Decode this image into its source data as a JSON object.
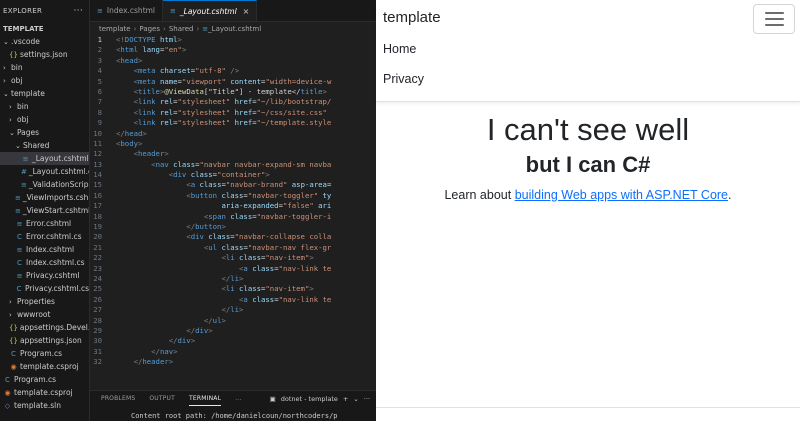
{
  "explorer": {
    "title": "EXPLORER",
    "menu_icon": "ellipsis-icon",
    "root": "TEMPLATE",
    "items": [
      {
        "label": ".vscode",
        "kind": "folder",
        "open": true,
        "depth": 0
      },
      {
        "label": "settings.json",
        "kind": "json",
        "depth": 1
      },
      {
        "label": "bin",
        "kind": "folder",
        "open": false,
        "depth": 0
      },
      {
        "label": "obj",
        "kind": "folder",
        "open": false,
        "depth": 0
      },
      {
        "label": "template",
        "kind": "folder",
        "open": true,
        "depth": 0
      },
      {
        "label": "bin",
        "kind": "folder",
        "open": false,
        "depth": 1
      },
      {
        "label": "obj",
        "kind": "folder",
        "open": false,
        "depth": 1
      },
      {
        "label": "Pages",
        "kind": "folder",
        "open": true,
        "depth": 1
      },
      {
        "label": "Shared",
        "kind": "folder",
        "open": true,
        "depth": 2
      },
      {
        "label": "_Layout.cshtml",
        "kind": "cshtml",
        "depth": 3,
        "selected": true
      },
      {
        "label": "_Layout.cshtml.css",
        "kind": "css",
        "depth": 3
      },
      {
        "label": "_ValidationScrip...",
        "kind": "cshtml",
        "depth": 3
      },
      {
        "label": "_ViewImports.csh...",
        "kind": "cshtml",
        "depth": 2
      },
      {
        "label": "_ViewStart.cshtml",
        "kind": "cshtml",
        "depth": 2
      },
      {
        "label": "Error.cshtml",
        "kind": "cshtml",
        "depth": 2
      },
      {
        "label": "Error.cshtml.cs",
        "kind": "cs",
        "depth": 2
      },
      {
        "label": "Index.cshtml",
        "kind": "cshtml",
        "depth": 2
      },
      {
        "label": "Index.cshtml.cs",
        "kind": "cs",
        "depth": 2
      },
      {
        "label": "Privacy.cshtml",
        "kind": "cshtml",
        "depth": 2
      },
      {
        "label": "Privacy.cshtml.cs",
        "kind": "cs",
        "depth": 2
      },
      {
        "label": "Properties",
        "kind": "folder",
        "open": false,
        "depth": 1
      },
      {
        "label": "wwwroot",
        "kind": "folder",
        "open": false,
        "depth": 1
      },
      {
        "label": "appsettings.Devel...",
        "kind": "json",
        "depth": 1
      },
      {
        "label": "appsettings.json",
        "kind": "json",
        "depth": 1
      },
      {
        "label": "Program.cs",
        "kind": "cs",
        "depth": 1
      },
      {
        "label": "template.csproj",
        "kind": "rss",
        "depth": 1
      },
      {
        "label": "Program.cs",
        "kind": "cs",
        "depth": 0
      },
      {
        "label": "template.csproj",
        "kind": "rss",
        "depth": 0
      },
      {
        "label": "template.sln",
        "kind": "sln",
        "depth": 0
      }
    ]
  },
  "tabs": [
    {
      "label": "Index.cshtml",
      "active": false
    },
    {
      "label": "_Layout.cshtml",
      "active": true,
      "close": "×"
    }
  ],
  "breadcrumb": [
    "template",
    "Pages",
    "Shared",
    "_Layout.cshtml"
  ],
  "code": {
    "current_line": 1,
    "lines": [
      [
        [
          "p",
          "<!"
        ],
        [
          "t",
          "DOCTYPE"
        ],
        [
          "a",
          " html"
        ],
        [
          "p",
          ">"
        ]
      ],
      [
        [
          "p",
          "<"
        ],
        [
          "t",
          "html"
        ],
        [
          "a",
          " lang"
        ],
        [
          "d",
          "="
        ],
        [
          "s",
          "\"en\""
        ],
        [
          "p",
          ">"
        ]
      ],
      [
        [
          "p",
          "<"
        ],
        [
          "t",
          "head"
        ],
        [
          "p",
          ">"
        ]
      ],
      [
        [
          "d",
          "    "
        ],
        [
          "p",
          "<"
        ],
        [
          "t",
          "meta"
        ],
        [
          "a",
          " charset"
        ],
        [
          "d",
          "="
        ],
        [
          "s",
          "\"utf-8\""
        ],
        [
          "d",
          " "
        ],
        [
          "p",
          "/>"
        ]
      ],
      [
        [
          "d",
          "    "
        ],
        [
          "p",
          "<"
        ],
        [
          "t",
          "meta"
        ],
        [
          "a",
          " name"
        ],
        [
          "d",
          "="
        ],
        [
          "s",
          "\"viewport\""
        ],
        [
          "a",
          " content"
        ],
        [
          "d",
          "="
        ],
        [
          "s",
          "\"width=device-w"
        ]
      ],
      [
        [
          "d",
          "    "
        ],
        [
          "p",
          "<"
        ],
        [
          "t",
          "title"
        ],
        [
          "p",
          ">"
        ],
        [
          "r",
          "@ViewData"
        ],
        [
          "d",
          "[\"Title\"] - template</"
        ],
        [
          "t",
          "title"
        ],
        [
          "p",
          ">"
        ]
      ],
      [
        [
          "d",
          "    "
        ],
        [
          "p",
          "<"
        ],
        [
          "t",
          "link"
        ],
        [
          "a",
          " rel"
        ],
        [
          "d",
          "="
        ],
        [
          "s",
          "\"stylesheet\""
        ],
        [
          "a",
          " href"
        ],
        [
          "d",
          "="
        ],
        [
          "s",
          "\"~/lib/bootstrap/"
        ]
      ],
      [
        [
          "d",
          "    "
        ],
        [
          "p",
          "<"
        ],
        [
          "t",
          "link"
        ],
        [
          "a",
          " rel"
        ],
        [
          "d",
          "="
        ],
        [
          "s",
          "\"stylesheet\""
        ],
        [
          "a",
          " href"
        ],
        [
          "d",
          "="
        ],
        [
          "s",
          "\"~/css/site.css\""
        ]
      ],
      [
        [
          "d",
          "    "
        ],
        [
          "p",
          "<"
        ],
        [
          "t",
          "link"
        ],
        [
          "a",
          " rel"
        ],
        [
          "d",
          "="
        ],
        [
          "s",
          "\"stylesheet\""
        ],
        [
          "a",
          " href"
        ],
        [
          "d",
          "="
        ],
        [
          "s",
          "\"~/template.style"
        ]
      ],
      [
        [
          "p",
          "</"
        ],
        [
          "t",
          "head"
        ],
        [
          "p",
          ">"
        ]
      ],
      [
        [
          "p",
          "<"
        ],
        [
          "t",
          "body"
        ],
        [
          "p",
          ">"
        ]
      ],
      [
        [
          "d",
          "    "
        ],
        [
          "p",
          "<"
        ],
        [
          "t",
          "header"
        ],
        [
          "p",
          ">"
        ]
      ],
      [
        [
          "d",
          "        "
        ],
        [
          "p",
          "<"
        ],
        [
          "t",
          "nav"
        ],
        [
          "a",
          " class"
        ],
        [
          "d",
          "="
        ],
        [
          "s",
          "\"navbar navbar-expand-sm navba"
        ]
      ],
      [
        [
          "d",
          "            "
        ],
        [
          "p",
          "<"
        ],
        [
          "t",
          "div"
        ],
        [
          "a",
          " class"
        ],
        [
          "d",
          "="
        ],
        [
          "s",
          "\"container\""
        ],
        [
          "p",
          ">"
        ]
      ],
      [
        [
          "d",
          "                "
        ],
        [
          "p",
          "<"
        ],
        [
          "t",
          "a"
        ],
        [
          "a",
          " class"
        ],
        [
          "d",
          "="
        ],
        [
          "s",
          "\"navbar-brand\""
        ],
        [
          "a",
          " asp-area"
        ],
        [
          "d",
          "="
        ]
      ],
      [
        [
          "d",
          "                "
        ],
        [
          "p",
          "<"
        ],
        [
          "t",
          "button"
        ],
        [
          "a",
          " class"
        ],
        [
          "d",
          "="
        ],
        [
          "s",
          "\"navbar-toggler\""
        ],
        [
          "a",
          " ty"
        ]
      ],
      [
        [
          "d",
          "                        "
        ],
        [
          "a",
          "aria-expanded"
        ],
        [
          "d",
          "="
        ],
        [
          "s",
          "\"false\""
        ],
        [
          "a",
          " ari"
        ]
      ],
      [
        [
          "d",
          "                    "
        ],
        [
          "p",
          "<"
        ],
        [
          "t",
          "span"
        ],
        [
          "a",
          " class"
        ],
        [
          "d",
          "="
        ],
        [
          "s",
          "\"navbar-toggler-i"
        ]
      ],
      [
        [
          "d",
          "                "
        ],
        [
          "p",
          "</"
        ],
        [
          "t",
          "button"
        ],
        [
          "p",
          ">"
        ]
      ],
      [
        [
          "d",
          "                "
        ],
        [
          "p",
          "<"
        ],
        [
          "t",
          "div"
        ],
        [
          "a",
          " class"
        ],
        [
          "d",
          "="
        ],
        [
          "s",
          "\"navbar-collapse colla"
        ]
      ],
      [
        [
          "d",
          "                    "
        ],
        [
          "p",
          "<"
        ],
        [
          "t",
          "ul"
        ],
        [
          "a",
          " class"
        ],
        [
          "d",
          "="
        ],
        [
          "s",
          "\"navbar-nav flex-gr"
        ]
      ],
      [
        [
          "d",
          "                        "
        ],
        [
          "p",
          "<"
        ],
        [
          "t",
          "li"
        ],
        [
          "a",
          " class"
        ],
        [
          "d",
          "="
        ],
        [
          "s",
          "\"nav-item\""
        ],
        [
          "p",
          ">"
        ]
      ],
      [
        [
          "d",
          "                            "
        ],
        [
          "p",
          "<"
        ],
        [
          "t",
          "a"
        ],
        [
          "a",
          " class"
        ],
        [
          "d",
          "="
        ],
        [
          "s",
          "\"nav-link te"
        ]
      ],
      [
        [
          "d",
          "                        "
        ],
        [
          "p",
          "</"
        ],
        [
          "t",
          "li"
        ],
        [
          "p",
          ">"
        ]
      ],
      [
        [
          "d",
          "                        "
        ],
        [
          "p",
          "<"
        ],
        [
          "t",
          "li"
        ],
        [
          "a",
          " class"
        ],
        [
          "d",
          "="
        ],
        [
          "s",
          "\"nav-item\""
        ],
        [
          "p",
          ">"
        ]
      ],
      [
        [
          "d",
          "                            "
        ],
        [
          "p",
          "<"
        ],
        [
          "t",
          "a"
        ],
        [
          "a",
          " class"
        ],
        [
          "d",
          "="
        ],
        [
          "s",
          "\"nav-link te"
        ]
      ],
      [
        [
          "d",
          "                        "
        ],
        [
          "p",
          "</"
        ],
        [
          "t",
          "li"
        ],
        [
          "p",
          ">"
        ]
      ],
      [
        [
          "d",
          "                    "
        ],
        [
          "p",
          "</"
        ],
        [
          "t",
          "ul"
        ],
        [
          "p",
          ">"
        ]
      ],
      [
        [
          "d",
          "                "
        ],
        [
          "p",
          "</"
        ],
        [
          "t",
          "div"
        ],
        [
          "p",
          ">"
        ]
      ],
      [
        [
          "d",
          "            "
        ],
        [
          "p",
          "</"
        ],
        [
          "t",
          "div"
        ],
        [
          "p",
          ">"
        ]
      ],
      [
        [
          "d",
          "        "
        ],
        [
          "p",
          "</"
        ],
        [
          "t",
          "nav"
        ],
        [
          "p",
          ">"
        ]
      ],
      [
        [
          "d",
          "    "
        ],
        [
          "p",
          "</"
        ],
        [
          "t",
          "header"
        ],
        [
          "p",
          ">"
        ]
      ]
    ]
  },
  "panel": {
    "tabs": [
      "PROBLEMS",
      "OUTPUT",
      "TERMINAL",
      "..."
    ],
    "active_tab": 2,
    "terminal_name": "dotnet - template",
    "terminal_line": "Content root path: /home/danielcoun/northcoders/p"
  },
  "web": {
    "brand": "template",
    "nav_links": [
      "Home",
      "Privacy"
    ],
    "heading": "I can't see well",
    "subheading": "but I can C#",
    "lead_prefix": "Learn about ",
    "lead_link": "building Web apps with ASP.NET Core",
    "lead_suffix": "."
  },
  "colors": {
    "accent": "#0078d4",
    "link": "#0d6efd",
    "editor_bg": "#1f1f1f"
  }
}
